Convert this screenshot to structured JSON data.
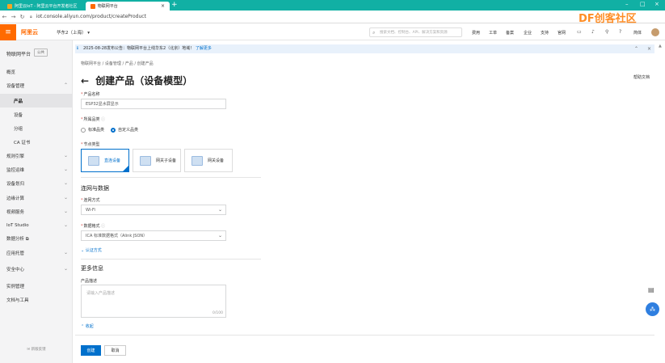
{
  "browser": {
    "tabs": [
      {
        "title": "阿里云IoT - 阿里云平台开发者社区",
        "active": false
      },
      {
        "title": "物联网平台",
        "active": true
      }
    ],
    "new_tab": "+",
    "url": "iot.console.aliyun.com/product/createProduct",
    "minimize": "–",
    "maximize": "□",
    "close": "×"
  },
  "console": {
    "menu_icon": "≡",
    "logo": "阿里云",
    "region": "华东2（上海）",
    "search_placeholder": "搜索文档、控制台、API、解决方案和资源",
    "top_links": [
      "费用",
      "工单",
      "备案",
      "企业",
      "支持",
      "官网"
    ],
    "user": "简体",
    "watermark": "DF创客社区"
  },
  "sidenav": {
    "title": "物联网平台",
    "badge": "公共",
    "items": [
      {
        "label": "概览",
        "sub": false,
        "active": false,
        "chev": ""
      },
      {
        "label": "设备管理",
        "sub": false,
        "active": false,
        "chev": "⌃"
      },
      {
        "label": "产品",
        "sub": true,
        "active": true,
        "chev": ""
      },
      {
        "label": "设备",
        "sub": true,
        "active": false,
        "chev": ""
      },
      {
        "label": "分组",
        "sub": true,
        "active": false,
        "chev": ""
      },
      {
        "label": "CA 证书",
        "sub": true,
        "active": false,
        "chev": ""
      },
      {
        "label": "规则引擎",
        "sub": false,
        "active": false,
        "chev": "⌄"
      },
      {
        "label": "监控运维",
        "sub": false,
        "active": false,
        "chev": "⌄"
      },
      {
        "label": "设备划归",
        "sub": false,
        "active": false,
        "chev": "⌄"
      },
      {
        "label": "边缘计算",
        "sub": false,
        "active": false,
        "chev": "⌄"
      },
      {
        "label": "视频服务",
        "sub": false,
        "active": false,
        "chev": "⌄"
      },
      {
        "label": "IoT Studio",
        "sub": false,
        "active": false,
        "chev": "⌄"
      },
      {
        "label": "数据分析 ⧉",
        "sub": false,
        "active": false,
        "chev": ""
      },
      {
        "label": "应用托管",
        "sub": false,
        "active": false,
        "chev": "⌄"
      },
      {
        "label": "安全中心",
        "sub": false,
        "active": false,
        "chev": "⌄"
      },
      {
        "label": "实例管理",
        "sub": false,
        "active": false,
        "chev": ""
      },
      {
        "label": "文档与工具",
        "sub": false,
        "active": false,
        "chev": ""
      }
    ],
    "footer": "新版反馈"
  },
  "notice": {
    "text": "2025-08-28发布公告：物联网平台上线华东2（北京）地域！",
    "link": "了解更多",
    "close": "×"
  },
  "main": {
    "breadcrumb": "物联网平台   /   设备管理   /   产品   /   创建产品",
    "title": "创建产品（设备模型）",
    "back_icon": "←",
    "help": "帮助文档",
    "product_name_label": "产品名称",
    "product_name_value": "ESP32显水屏显示",
    "category_label": "所属品类",
    "category_options": [
      "标准品类",
      "自定义品类"
    ],
    "category_selected": 1,
    "node_type_label": "节点类型",
    "node_types": [
      "直连设备",
      "网关子设备",
      "网关设备"
    ],
    "node_selected": 0,
    "section_network": "连网与数据",
    "network_label": "连网方式",
    "network_value": "Wi-Fi",
    "data_format_label": "数据格式",
    "data_format_value": "ICA 标准数据格式（Alink JSON）",
    "auth_toggle": "认证方式",
    "section_more": "更多信息",
    "desc_label": "产品描述",
    "desc_placeholder": "请输入产品描述",
    "desc_count": "0/100",
    "collapse": "收起",
    "create_button": "创建",
    "cancel_button": "取消"
  }
}
